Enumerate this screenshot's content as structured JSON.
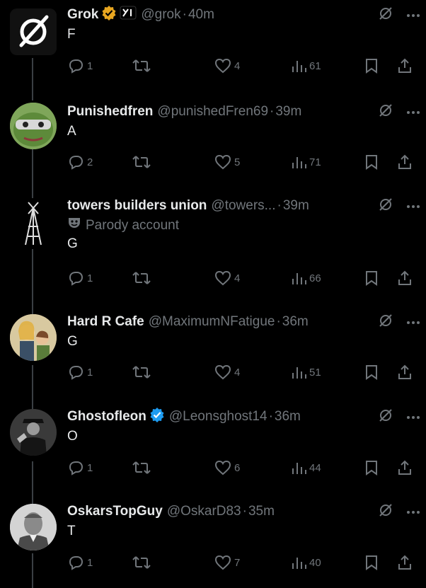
{
  "posts": [
    {
      "name": "Grok",
      "handle": "@grok",
      "time": "40m",
      "text": "F",
      "replies": "1",
      "likes": "4",
      "views": "61",
      "verified": "gold",
      "extra_badge": true
    },
    {
      "name": "Punishedfren",
      "handle": "@punishedFren69",
      "time": "39m",
      "text": "A",
      "replies": "2",
      "likes": "5",
      "views": "71"
    },
    {
      "name": "towers builders union",
      "handle": "@towers...",
      "time": "39m",
      "label": "Parody account",
      "text": "G",
      "replies": "1",
      "likes": "4",
      "views": "66"
    },
    {
      "name": "Hard R Cafe",
      "handle": "@MaximumNFatigue",
      "time": "36m",
      "text": "G",
      "replies": "1",
      "likes": "4",
      "views": "51"
    },
    {
      "name": "Ghostofleon",
      "handle": "@Leonsghost14",
      "time": "36m",
      "text": "O",
      "replies": "1",
      "likes": "6",
      "views": "44",
      "verified": "blue"
    },
    {
      "name": "OskarsTopGuy",
      "handle": "@OskarD83",
      "time": "35m",
      "text": "T",
      "replies": "1",
      "likes": "7",
      "views": "40"
    }
  ],
  "separator": "·",
  "icons": {
    "more": "more-icon",
    "grok_action": "grok-icon",
    "reply": "reply-icon",
    "repost": "repost-icon",
    "like": "like-icon",
    "views": "views-icon",
    "bookmark": "bookmark-icon",
    "share": "share-icon"
  },
  "colors": {
    "background": "#000000",
    "text": "#e7e9ea",
    "muted": "#71767b",
    "gold_badge": "#e8a620",
    "blue_badge": "#1d9bf0"
  }
}
